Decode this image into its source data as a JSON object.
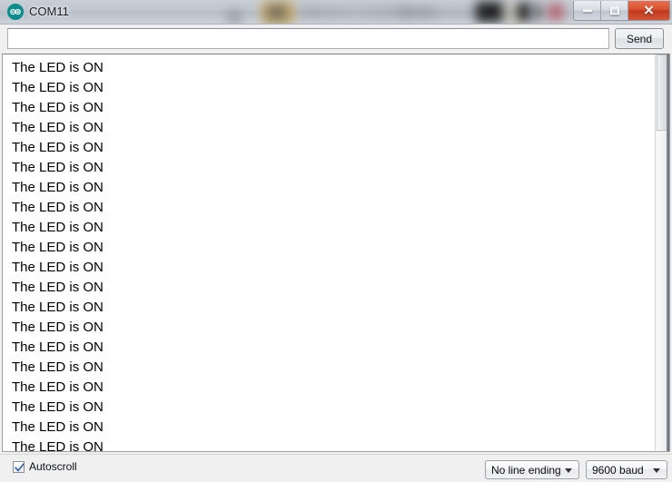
{
  "window": {
    "title": "COM11",
    "app_icon": "arduino-logo-icon",
    "controls": {
      "minimize": "Minimize",
      "maximize": "Maximize",
      "close": "Close"
    },
    "accent_close": "#c0391c",
    "accent_logo": "#0e8b8c"
  },
  "send_row": {
    "input_value": "",
    "input_placeholder": "",
    "send_label": "Send"
  },
  "output": {
    "lines": [
      "The LED is ON",
      "The LED is ON",
      "The LED is ON",
      "The LED is ON",
      "The LED is ON",
      "The LED is ON",
      "The LED is ON",
      "The LED is ON",
      "The LED is ON",
      "The LED is ON",
      "The LED is ON",
      "The LED is ON",
      "The LED is ON",
      "The LED is ON",
      "The LED is ON",
      "The LED is ON",
      "The LED is ON",
      "The LED is ON",
      "The LED is ON",
      "The LED is ON"
    ]
  },
  "status_bar": {
    "autoscroll_label": "Autoscroll",
    "autoscroll_checked": true,
    "line_ending_value": "No line ending",
    "baud_value": "9600 baud"
  }
}
